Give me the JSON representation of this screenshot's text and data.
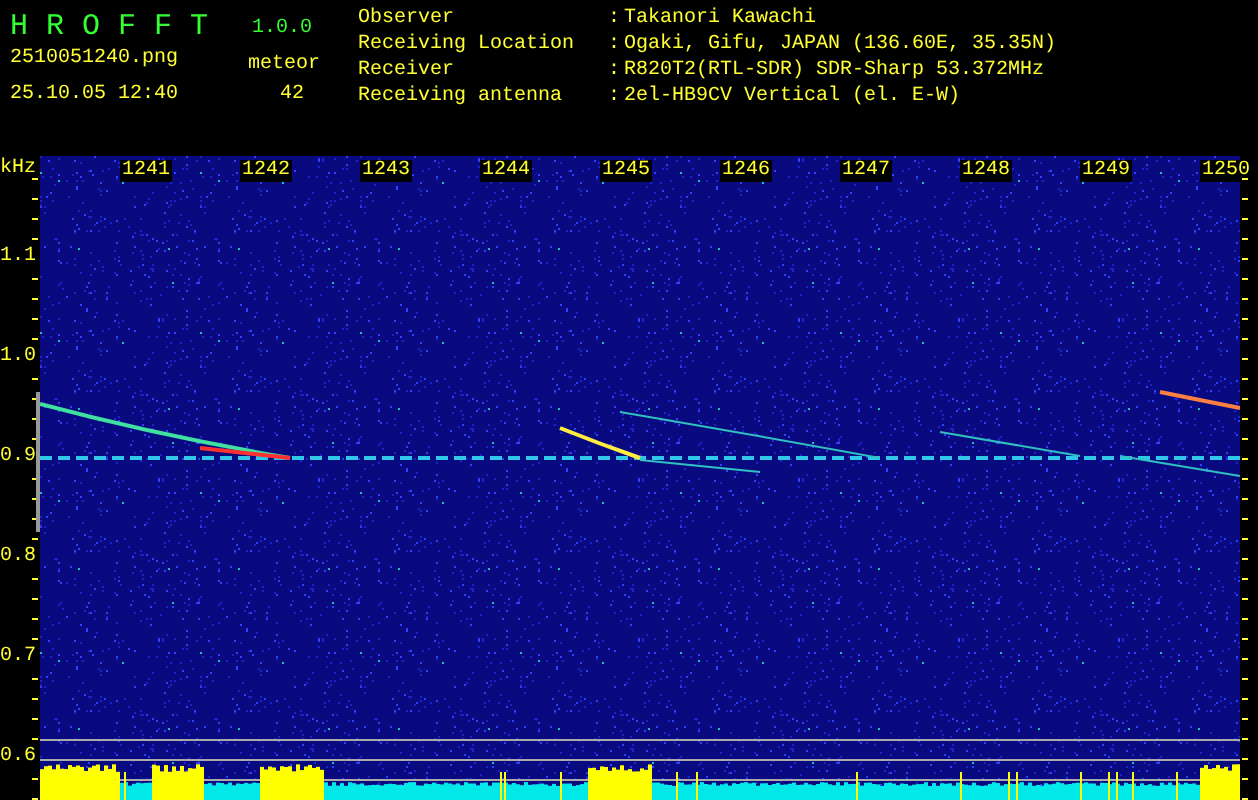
{
  "app": {
    "name": "H R O F F T",
    "version": "1.0.0"
  },
  "file": {
    "name": "2510051240.png",
    "timestamp": "25.10.05 12:40"
  },
  "counter": {
    "label": "meteor",
    "count": "42"
  },
  "station_info": [
    {
      "label": "Observer",
      "separator": ":",
      "value": "Takanori Kawachi"
    },
    {
      "label": "Receiving Location",
      "separator": ":",
      "value": "Ogaki, Gifu, JAPAN (136.60E, 35.35N)"
    },
    {
      "label": "Receiver",
      "separator": ":",
      "value": "R820T2(RTL-SDR) SDR-Sharp 53.372MHz"
    },
    {
      "label": "Receiving antenna",
      "separator": ":",
      "value": "2el-HB9CV Vertical (el. E-W)"
    }
  ],
  "spectrogram": {
    "y_unit": "kHz",
    "y_labels": [
      "1.1",
      "1.0",
      "0.9",
      "0.8",
      "0.7",
      "0.6"
    ],
    "time_labels": [
      "1241",
      "1242",
      "1243",
      "1244",
      "1245",
      "1246",
      "1247",
      "1248",
      "1249",
      "1250"
    ]
  }
}
